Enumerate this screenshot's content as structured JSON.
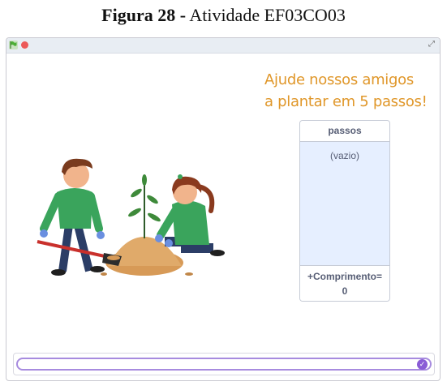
{
  "caption": {
    "bold": "Figura 28 -",
    "rest": " Atividade EF03CO03"
  },
  "stage": {
    "title_line1": "Ajude nossos amigos",
    "title_line2": "a plantar em 5 passos!"
  },
  "list": {
    "header": "passos",
    "empty_text": "(vazio)",
    "length_label": "+Comprimento=",
    "length_value": "0"
  },
  "answer": {
    "value": ""
  },
  "colors": {
    "title": "#e0972a",
    "list_bg": "#e6efff",
    "accent": "#8a5cd6"
  },
  "icons": [
    "green-flag-icon",
    "stop-icon",
    "fullscreen-icon",
    "check-icon"
  ]
}
